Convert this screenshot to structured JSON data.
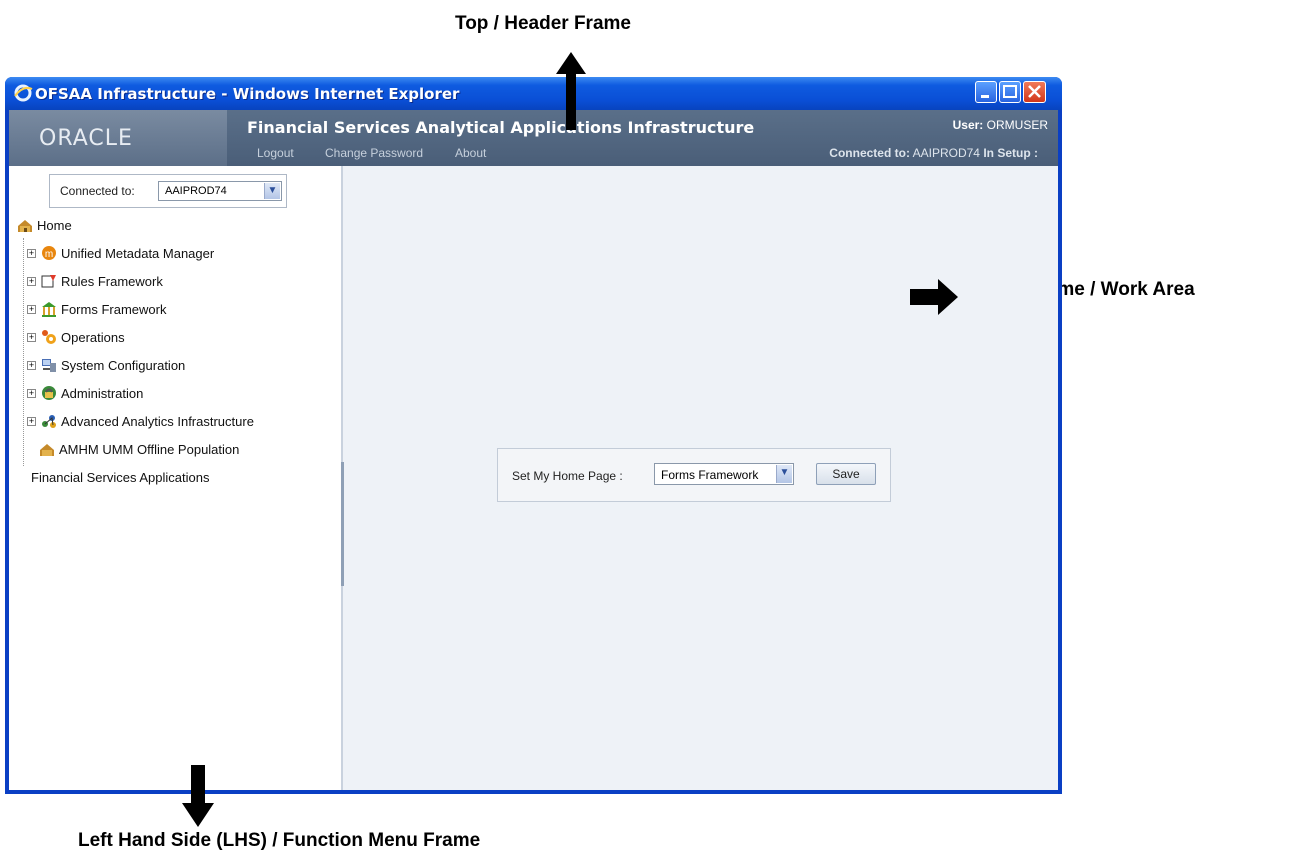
{
  "annotations": {
    "top": "Top / Header Frame",
    "right": "Right Frame / Work Area",
    "left": "Left Hand Side (LHS) / Function Menu Frame"
  },
  "window": {
    "title": "OFSAA Infrastructure - Windows Internet Explorer"
  },
  "header": {
    "logo": "ORACLE",
    "app_title": "Financial Services Analytical Applications Infrastructure",
    "links": [
      "Logout",
      "Change Password",
      "About"
    ],
    "user_label": "User:",
    "user_value": "ORMUSER",
    "connected_label": "Connected to:",
    "connected_value": "AAIPROD74",
    "setup_label": "In Setup :"
  },
  "lhs": {
    "connected_label": "Connected to:",
    "connected_value": "AAIPROD74",
    "home": "Home",
    "items": [
      {
        "label": "Unified Metadata Manager",
        "icon": "metadata-icon"
      },
      {
        "label": "Rules Framework",
        "icon": "rules-icon"
      },
      {
        "label": "Forms Framework",
        "icon": "forms-icon"
      },
      {
        "label": "Operations",
        "icon": "operations-icon"
      },
      {
        "label": "System Configuration",
        "icon": "system-config-icon"
      },
      {
        "label": "Administration",
        "icon": "administration-icon"
      },
      {
        "label": "Advanced Analytics Infrastructure",
        "icon": "analytics-icon"
      }
    ],
    "leaf1": "AMHM UMM Offline Population",
    "leaf2": "Financial Services Applications"
  },
  "work": {
    "home_page_label": "Set My Home Page :",
    "home_page_value": "Forms Framework",
    "save_label": "Save"
  },
  "colors": {
    "titlebar": "#0a4fd6",
    "header_bg": "#4f637d",
    "work_bg": "#eef2f7"
  }
}
